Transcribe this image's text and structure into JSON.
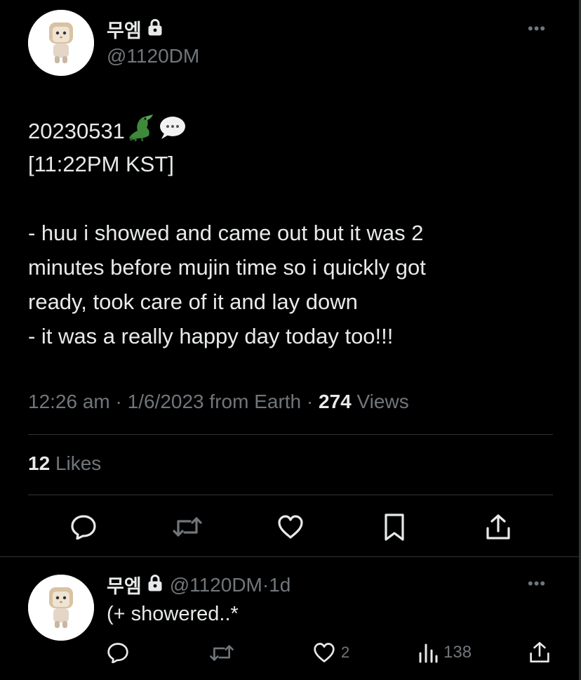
{
  "tweet": {
    "display_name": "무엠",
    "handle": "@1120DM",
    "text_lines": [
      "20230531",
      "[11:22PM KST]",
      "",
      "- huu i showed and came out but it was 2",
      "minutes before mujin time so i quickly got",
      "ready, took care of it and lay down",
      "- it was a really happy day today too!!!"
    ],
    "time": "12:26 am",
    "date": "1/6/2023",
    "source": "from Earth",
    "views_count": "274",
    "views_label": "Views",
    "likes_count": "12",
    "likes_label": "Likes",
    "more_label": "•••",
    "separator": "·",
    "emojis": [
      "crocodile-emoji",
      "speech-bubble-emoji"
    ]
  },
  "reply": {
    "display_name": "무엠",
    "handle": "@1120DM",
    "separator": "·",
    "time_ago": "1d",
    "text": "(+ showered..*",
    "likes": "2",
    "views": "138",
    "more_label": "•••"
  },
  "icons": {
    "reply": "reply-icon",
    "retweet": "retweet-icon",
    "like": "heart-icon",
    "bookmark": "bookmark-icon",
    "share": "share-icon",
    "views": "views-icon",
    "lock": "lock-icon"
  }
}
